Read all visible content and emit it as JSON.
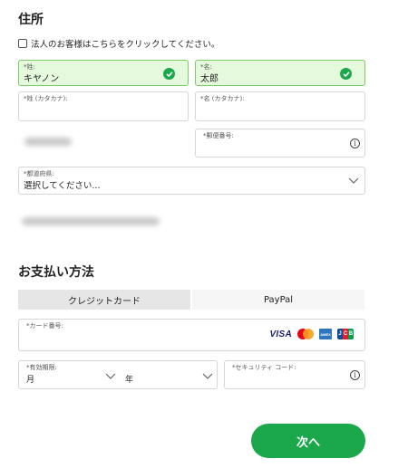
{
  "address": {
    "title": "住所",
    "corporate_checkbox_label": "法人のお客様はこちらをクリックしてください。",
    "corporate_checked": false,
    "last_name": {
      "label": "*姓:",
      "value": "キヤノン"
    },
    "first_name": {
      "label": "*名:",
      "value": "太郎"
    },
    "last_name_kana": {
      "label": "*姓 (カタカナ):",
      "value": ""
    },
    "first_name_kana": {
      "label": "*名 (カタカナ):",
      "value": ""
    },
    "postal_code": {
      "label": "*郵便番号:",
      "value": ""
    },
    "prefecture": {
      "label": "*都道府県:",
      "value": "選択してください..."
    }
  },
  "payment": {
    "title": "お支払い方法",
    "tabs": [
      {
        "label": "クレジットカード",
        "active": true
      },
      {
        "label": "PayPal",
        "active": false
      }
    ],
    "card_number": {
      "label": "*カード番号:",
      "value": ""
    },
    "card_brands": [
      "VISA",
      "mastercard",
      "AMEX",
      "JCB"
    ],
    "expiry": {
      "label": "*有効期限:",
      "month": "月",
      "year": "年"
    },
    "security_code": {
      "label": "*セキュリティ コード:",
      "value": ""
    }
  },
  "next_button": {
    "label": "次へ"
  },
  "colors": {
    "accent_green": "#1aa84b",
    "valid_bg": "#e5f9dd",
    "valid_border": "#7ecb69"
  }
}
